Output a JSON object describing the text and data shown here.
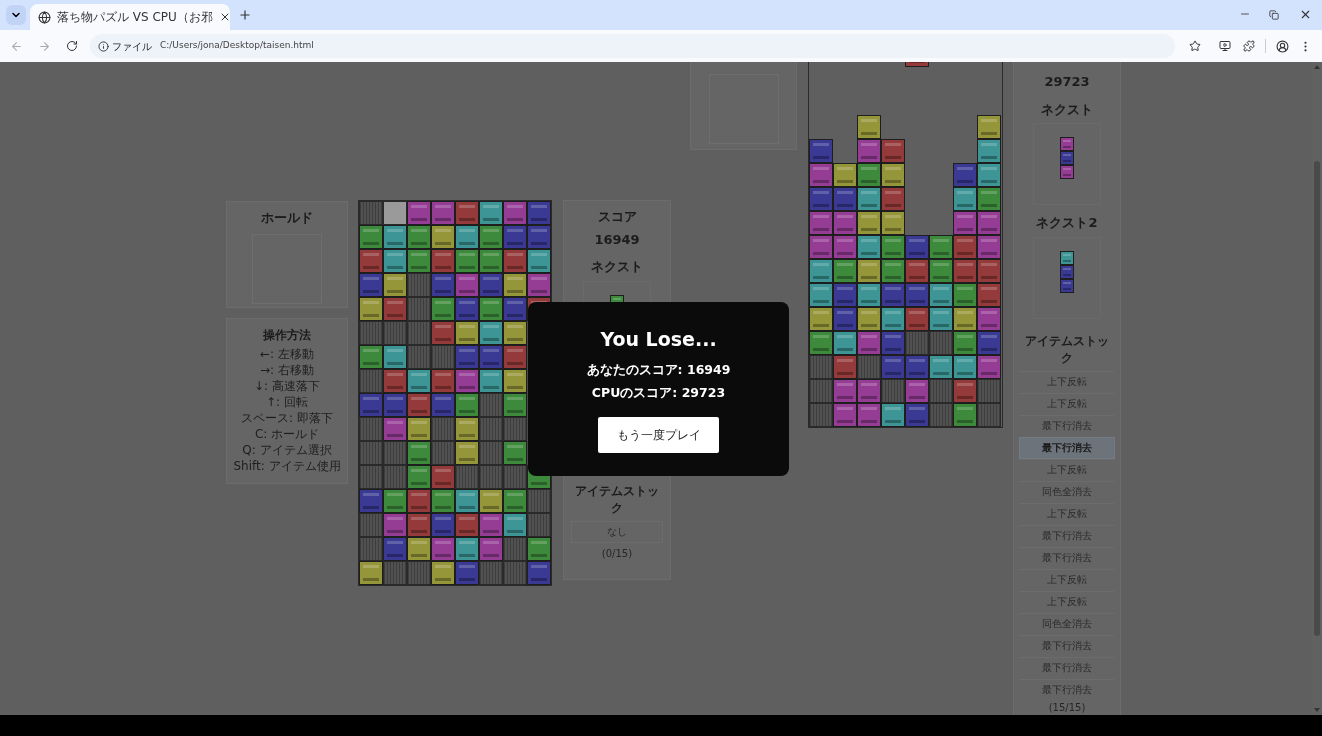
{
  "browser": {
    "tab_title": "落ち物パズル VS CPU（お邪",
    "address_label": "ファイル",
    "url": "C:/Users/jona/Desktop/taisen.html"
  },
  "player": {
    "hold": {
      "title": "ホールド"
    },
    "controls": {
      "title": "操作方法",
      "lines": [
        "←: 左移動",
        "→: 右移動",
        "↓: 高速落下",
        "↑: 回転",
        "スペース: 即落下",
        "C: ホールド",
        "Q: アイテム選択",
        "Shift: アイテム使用"
      ]
    },
    "board": {
      "rows": [
        {
          "cells": [
            {
              "kind": "garbage"
            },
            {
              "kind": "blank"
            },
            {
              "kind": "block",
              "color": "#953c95"
            },
            {
              "kind": "block",
              "color": "#953c95"
            },
            {
              "kind": "block",
              "color": "#953a3a"
            },
            {
              "kind": "block",
              "color": "#3d9595"
            },
            {
              "kind": "block",
              "color": "#953c95"
            },
            {
              "kind": "block",
              "color": "#3a3a95"
            }
          ]
        },
        {
          "cells": [
            {
              "kind": "block",
              "color": "#3d8a3d"
            },
            {
              "kind": "block",
              "color": "#3d9595"
            },
            {
              "kind": "block",
              "color": "#3d8a3d"
            },
            {
              "kind": "block",
              "color": "#95953a"
            },
            {
              "kind": "block",
              "color": "#3d9595"
            },
            {
              "kind": "block",
              "color": "#3d8a3d"
            },
            {
              "kind": "block",
              "color": "#3a3a95"
            },
            {
              "kind": "block",
              "color": "#3a3a95"
            }
          ]
        },
        {
          "cells": [
            {
              "kind": "block",
              "color": "#953a3a"
            },
            {
              "kind": "block",
              "color": "#3d9595"
            },
            {
              "kind": "block",
              "color": "#3d8a3d"
            },
            {
              "kind": "block",
              "color": "#953a3a"
            },
            {
              "kind": "block",
              "color": "#3d8a3d"
            },
            {
              "kind": "block",
              "color": "#3d8a3d"
            },
            {
              "kind": "block",
              "color": "#953a3a"
            },
            {
              "kind": "block",
              "color": "#3d9595"
            }
          ]
        },
        {
          "cells": [
            {
              "kind": "block",
              "color": "#3a3a95"
            },
            {
              "kind": "block",
              "color": "#95953a"
            },
            {
              "kind": "garbage"
            },
            {
              "kind": "block",
              "color": "#3a3a95"
            },
            {
              "kind": "block",
              "color": "#953c95"
            },
            {
              "kind": "block",
              "color": "#3a3a95"
            },
            {
              "kind": "block",
              "color": "#95953a"
            },
            {
              "kind": "block",
              "color": "#953c95"
            }
          ]
        },
        {
          "cells": [
            {
              "kind": "block",
              "color": "#95953a"
            },
            {
              "kind": "block",
              "color": "#953a3a"
            },
            {
              "kind": "garbage"
            },
            {
              "kind": "block",
              "color": "#3d8a3d"
            },
            {
              "kind": "block",
              "color": "#3a3a95"
            },
            {
              "kind": "block",
              "color": "#3d8a3d"
            },
            {
              "kind": "block",
              "color": "#3a3a95"
            },
            {
              "kind": "block",
              "color": "#953a3a"
            }
          ]
        },
        {
          "cells": [
            {
              "kind": "garbage"
            },
            {
              "kind": "garbage"
            },
            {
              "kind": "garbage"
            },
            {
              "kind": "block",
              "color": "#953a3a"
            },
            {
              "kind": "block",
              "color": "#95953a"
            },
            {
              "kind": "block",
              "color": "#3d9595"
            },
            {
              "kind": "block",
              "color": "#95953a"
            }
          ]
        },
        {
          "cells": [
            {
              "kind": "block",
              "color": "#3d8a3d"
            },
            {
              "kind": "block",
              "color": "#3d9595"
            },
            {
              "kind": "garbage"
            },
            {
              "kind": "garbage"
            },
            {
              "kind": "block",
              "color": "#3a3a95"
            },
            {
              "kind": "block",
              "color": "#3a3a95"
            },
            {
              "kind": "block",
              "color": "#953a3a"
            }
          ]
        },
        {
          "cells": [
            {
              "kind": "garbage"
            },
            {
              "kind": "block",
              "color": "#953a3a"
            },
            {
              "kind": "block",
              "color": "#3d9595"
            },
            {
              "kind": "block",
              "color": "#953a3a"
            },
            {
              "kind": "block",
              "color": "#953c95"
            },
            {
              "kind": "block",
              "color": "#3d9595"
            },
            {
              "kind": "block",
              "color": "#95953a"
            }
          ]
        },
        {
          "cells": [
            {
              "kind": "block",
              "color": "#3a3a95"
            },
            {
              "kind": "block",
              "color": "#3a3a95"
            },
            {
              "kind": "block",
              "color": "#953a3a"
            },
            {
              "kind": "block",
              "color": "#3a3a95"
            },
            {
              "kind": "block",
              "color": "#3d8a3d"
            },
            {
              "kind": "garbage"
            },
            {
              "kind": "block",
              "color": "#3d8a3d"
            }
          ]
        },
        {
          "cells": [
            {
              "kind": "garbage"
            },
            {
              "kind": "block",
              "color": "#953c95"
            },
            {
              "kind": "block",
              "color": "#95953a"
            },
            {
              "kind": "garbage"
            },
            {
              "kind": "block",
              "color": "#95953a"
            },
            {
              "kind": "garbage"
            },
            {
              "kind": "garbage"
            }
          ]
        },
        {
          "cells": [
            {
              "kind": "garbage"
            },
            {
              "kind": "garbage"
            },
            {
              "kind": "block",
              "color": "#3d8a3d"
            },
            {
              "kind": "garbage"
            },
            {
              "kind": "block",
              "color": "#95953a"
            },
            {
              "kind": "garbage"
            },
            {
              "kind": "block",
              "color": "#3d8a3d"
            }
          ]
        },
        {
          "cells": [
            {
              "kind": "garbage"
            },
            {
              "kind": "garbage"
            },
            {
              "kind": "block",
              "color": "#3d8a3d"
            },
            {
              "kind": "block",
              "color": "#953a3a"
            },
            {
              "kind": "garbage"
            },
            {
              "kind": "garbage"
            },
            {
              "kind": "garbage"
            },
            {
              "kind": "block",
              "color": "#3d8a3d"
            }
          ]
        },
        {
          "cells": [
            {
              "kind": "block",
              "color": "#3a3a95"
            },
            {
              "kind": "block",
              "color": "#3d8a3d"
            },
            {
              "kind": "block",
              "color": "#953a3a"
            },
            {
              "kind": "block",
              "color": "#3d8a3d"
            },
            {
              "kind": "block",
              "color": "#3d9595"
            },
            {
              "kind": "block",
              "color": "#95953a"
            },
            {
              "kind": "block",
              "color": "#3d8a3d"
            },
            {
              "kind": "garbage"
            }
          ]
        },
        {
          "cells": [
            {
              "kind": "garbage"
            },
            {
              "kind": "block",
              "color": "#953c95"
            },
            {
              "kind": "block",
              "color": "#953a3a"
            },
            {
              "kind": "block",
              "color": "#3a3a95"
            },
            {
              "kind": "block",
              "color": "#953a3a"
            },
            {
              "kind": "block",
              "color": "#953c95"
            },
            {
              "kind": "block",
              "color": "#3d9595"
            },
            {
              "kind": "garbage"
            }
          ]
        },
        {
          "cells": [
            {
              "kind": "garbage"
            },
            {
              "kind": "block",
              "color": "#3a3a95"
            },
            {
              "kind": "block",
              "color": "#95953a"
            },
            {
              "kind": "block",
              "color": "#953c95"
            },
            {
              "kind": "block",
              "color": "#3d9595"
            },
            {
              "kind": "block",
              "color": "#953c95"
            },
            {
              "kind": "garbage"
            },
            {
              "kind": "block",
              "color": "#3d8a3d"
            }
          ]
        },
        {
          "cells": [
            {
              "kind": "block",
              "color": "#95953a"
            },
            {
              "kind": "garbage"
            },
            {
              "kind": "garbage"
            },
            {
              "kind": "block",
              "color": "#95953a"
            },
            {
              "kind": "block",
              "color": "#3a3a95"
            },
            {
              "kind": "garbage"
            },
            {
              "kind": "garbage"
            },
            {
              "kind": "block",
              "color": "#3a3a95"
            }
          ]
        }
      ]
    },
    "score_label": "スコア",
    "score": "16949",
    "next": {
      "title": "ネクスト",
      "blocks": [
        {
          "color": "#3d8a3d"
        }
      ]
    },
    "item_stock": {
      "title": "アイテムストック",
      "empty_text": "なし",
      "count": "(0/15)"
    }
  },
  "cpu": {
    "board": {
      "rows": [
        {
          "cells": [
            {
              "kind": "empty"
            },
            {
              "kind": "empty"
            },
            {
              "kind": "empty"
            },
            {
              "kind": "empty"
            },
            {
              "kind": "block",
              "color": "#953a3a"
            },
            {
              "kind": "empty"
            },
            {
              "kind": "empty"
            },
            {
              "kind": "empty"
            }
          ]
        },
        {
          "cells": [
            {
              "kind": "empty"
            },
            {
              "kind": "empty"
            },
            {
              "kind": "empty"
            },
            {
              "kind": "empty"
            },
            {
              "kind": "empty"
            },
            {
              "kind": "empty"
            },
            {
              "kind": "empty"
            },
            {
              "kind": "empty"
            }
          ]
        },
        {
          "cells": [
            {
              "kind": "empty"
            },
            {
              "kind": "empty"
            },
            {
              "kind": "empty"
            },
            {
              "kind": "empty"
            },
            {
              "kind": "empty"
            },
            {
              "kind": "empty"
            },
            {
              "kind": "empty"
            },
            {
              "kind": "empty"
            }
          ]
        },
        {
          "cells": [
            {
              "kind": "empty"
            },
            {
              "kind": "empty"
            },
            {
              "kind": "block",
              "color": "#95953a"
            },
            {
              "kind": "empty"
            },
            {
              "kind": "empty"
            },
            {
              "kind": "empty"
            },
            {
              "kind": "empty"
            },
            {
              "kind": "block",
              "color": "#95953a"
            }
          ]
        },
        {
          "cells": [
            {
              "kind": "block",
              "color": "#3a3a95"
            },
            {
              "kind": "empty"
            },
            {
              "kind": "block",
              "color": "#953c95"
            },
            {
              "kind": "block",
              "color": "#953a3a"
            },
            {
              "kind": "empty"
            },
            {
              "kind": "empty"
            },
            {
              "kind": "empty"
            },
            {
              "kind": "block",
              "color": "#3d9595"
            }
          ]
        },
        {
          "cells": [
            {
              "kind": "block",
              "color": "#953c95"
            },
            {
              "kind": "block",
              "color": "#95953a"
            },
            {
              "kind": "block",
              "color": "#3d8a3d"
            },
            {
              "kind": "block",
              "color": "#95953a"
            },
            {
              "kind": "empty"
            },
            {
              "kind": "empty"
            },
            {
              "kind": "block",
              "color": "#3a3a95"
            },
            {
              "kind": "block",
              "color": "#3d9595"
            }
          ]
        },
        {
          "cells": [
            {
              "kind": "block",
              "color": "#3a3a95"
            },
            {
              "kind": "block",
              "color": "#3a3a95"
            },
            {
              "kind": "block",
              "color": "#3d9595"
            },
            {
              "kind": "block",
              "color": "#953a3a"
            },
            {
              "kind": "empty"
            },
            {
              "kind": "empty"
            },
            {
              "kind": "block",
              "color": "#3d9595"
            },
            {
              "kind": "block",
              "color": "#3d8a3d"
            }
          ]
        },
        {
          "cells": [
            {
              "kind": "block",
              "color": "#953c95"
            },
            {
              "kind": "block",
              "color": "#953c95"
            },
            {
              "kind": "block",
              "color": "#95953a"
            },
            {
              "kind": "block",
              "color": "#95953a"
            },
            {
              "kind": "empty"
            },
            {
              "kind": "empty"
            },
            {
              "kind": "block",
              "color": "#953c95"
            },
            {
              "kind": "block",
              "color": "#953c95"
            }
          ]
        },
        {
          "cells": [
            {
              "kind": "block",
              "color": "#953c95"
            },
            {
              "kind": "block",
              "color": "#953c95"
            },
            {
              "kind": "block",
              "color": "#3d9595"
            },
            {
              "kind": "block",
              "color": "#3d8a3d"
            },
            {
              "kind": "block",
              "color": "#3a3a95"
            },
            {
              "kind": "block",
              "color": "#3d8a3d"
            },
            {
              "kind": "block",
              "color": "#953a3a"
            },
            {
              "kind": "block",
              "color": "#953c95"
            }
          ]
        },
        {
          "cells": [
            {
              "kind": "block",
              "color": "#3d9595"
            },
            {
              "kind": "block",
              "color": "#3d8a3d"
            },
            {
              "kind": "block",
              "color": "#95953a"
            },
            {
              "kind": "block",
              "color": "#3d8a3d"
            },
            {
              "kind": "block",
              "color": "#953a3a"
            },
            {
              "kind": "block",
              "color": "#3d8a3d"
            },
            {
              "kind": "block",
              "color": "#953a3a"
            },
            {
              "kind": "block",
              "color": "#953a3a"
            }
          ]
        },
        {
          "cells": [
            {
              "kind": "block",
              "color": "#3d9595"
            },
            {
              "kind": "block",
              "color": "#3a3a95"
            },
            {
              "kind": "block",
              "color": "#3d9595"
            },
            {
              "kind": "block",
              "color": "#3a3a95"
            },
            {
              "kind": "block",
              "color": "#3a3a95"
            },
            {
              "kind": "block",
              "color": "#3d9595"
            },
            {
              "kind": "block",
              "color": "#3d8a3d"
            },
            {
              "kind": "block",
              "color": "#953a3a"
            }
          ]
        },
        {
          "cells": [
            {
              "kind": "block",
              "color": "#95953a"
            },
            {
              "kind": "block",
              "color": "#3a3a95"
            },
            {
              "kind": "block",
              "color": "#95953a"
            },
            {
              "kind": "block",
              "color": "#3d9595"
            },
            {
              "kind": "block",
              "color": "#953a3a"
            },
            {
              "kind": "block",
              "color": "#3d9595"
            },
            {
              "kind": "block",
              "color": "#95953a"
            },
            {
              "kind": "block",
              "color": "#953c95"
            }
          ]
        },
        {
          "cells": [
            {
              "kind": "block",
              "color": "#3d8a3d"
            },
            {
              "kind": "block",
              "color": "#3d9595"
            },
            {
              "kind": "block",
              "color": "#953c95"
            },
            {
              "kind": "block",
              "color": "#3a3a95"
            },
            {
              "kind": "garbage"
            },
            {
              "kind": "garbage"
            },
            {
              "kind": "block",
              "color": "#3d8a3d"
            },
            {
              "kind": "block",
              "color": "#3a3a95"
            }
          ]
        },
        {
          "cells": [
            {
              "kind": "garbage"
            },
            {
              "kind": "block",
              "color": "#953a3a"
            },
            {
              "kind": "garbage"
            },
            {
              "kind": "block",
              "color": "#3a3a95"
            },
            {
              "kind": "block",
              "color": "#3a3a95"
            },
            {
              "kind": "block",
              "color": "#3d9595"
            },
            {
              "kind": "block",
              "color": "#3d9595"
            },
            {
              "kind": "block",
              "color": "#953c95"
            }
          ]
        },
        {
          "cells": [
            {
              "kind": "garbage"
            },
            {
              "kind": "block",
              "color": "#953c95"
            },
            {
              "kind": "block",
              "color": "#953c95"
            },
            {
              "kind": "garbage"
            },
            {
              "kind": "block",
              "color": "#953c95"
            },
            {
              "kind": "garbage"
            },
            {
              "kind": "block",
              "color": "#953a3a"
            },
            {
              "kind": "garbage"
            }
          ]
        },
        {
          "cells": [
            {
              "kind": "garbage"
            },
            {
              "kind": "block",
              "color": "#953c95"
            },
            {
              "kind": "block",
              "color": "#953c95"
            },
            {
              "kind": "block",
              "color": "#3d9595"
            },
            {
              "kind": "block",
              "color": "#3a3a95"
            },
            {
              "kind": "garbage"
            },
            {
              "kind": "block",
              "color": "#3d8a3d"
            },
            {
              "kind": "garbage"
            }
          ]
        }
      ]
    },
    "score": "29723",
    "next": {
      "title": "ネクスト",
      "blocks": [
        {
          "color": "#953c95"
        },
        {
          "color": "#3a3a95"
        },
        {
          "color": "#953c95"
        }
      ]
    },
    "next2": {
      "title": "ネクスト2",
      "blocks": [
        {
          "color": "#3d9595"
        },
        {
          "color": "#3a3a95"
        },
        {
          "color": "#3a3a95"
        }
      ]
    },
    "item_stock": {
      "title": "アイテムストック",
      "count": "(15/15)",
      "items": [
        {
          "label": "上下反転",
          "selected": false
        },
        {
          "label": "上下反転",
          "selected": false
        },
        {
          "label": "最下行消去",
          "selected": false
        },
        {
          "label": "最下行消去",
          "selected": true
        },
        {
          "label": "上下反転",
          "selected": false
        },
        {
          "label": "同色全消去",
          "selected": false
        },
        {
          "label": "上下反転",
          "selected": false
        },
        {
          "label": "最下行消去",
          "selected": false
        },
        {
          "label": "最下行消去",
          "selected": false
        },
        {
          "label": "上下反転",
          "selected": false
        },
        {
          "label": "上下反転",
          "selected": false
        },
        {
          "label": "同色全消去",
          "selected": false
        },
        {
          "label": "最下行消去",
          "selected": false
        },
        {
          "label": "最下行消去",
          "selected": false
        },
        {
          "label": "最下行消去",
          "selected": false
        }
      ]
    }
  },
  "dialog": {
    "title": "You Lose...",
    "lines": [
      "あなたのスコア: 16949",
      "CPUのスコア: 29723"
    ],
    "button": "もう一度プレイ"
  }
}
